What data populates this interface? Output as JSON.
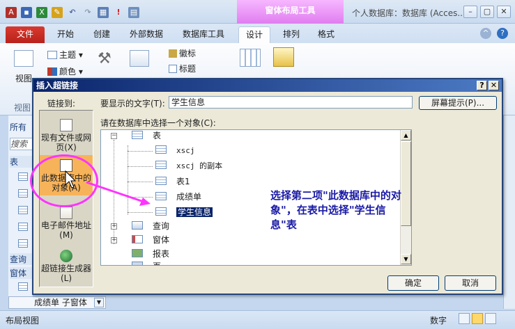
{
  "app": {
    "title": "个人数据库：数据库 (Acces...",
    "context_tab": "窗体布局工具",
    "tabs": [
      "文件",
      "开始",
      "创建",
      "外部数据",
      "数据库工具",
      "设计",
      "排列",
      "格式"
    ]
  },
  "ribbon": {
    "view": "视图",
    "theme": "主题",
    "colors": "颜色",
    "logo": "徽标",
    "title": "标题",
    "view_group": "视图"
  },
  "nav": {
    "all": "所有",
    "search": "搜索",
    "tables": "表",
    "queries": "查询",
    "forms": "窗体"
  },
  "form_tab": "成绩单 子窗体",
  "status": {
    "left": "布局视图",
    "right": "数字"
  },
  "dialog": {
    "title": "插入超链接",
    "help_btn": "?",
    "close_btn": "✕",
    "link_to_label": "链接到:",
    "link_options": {
      "existing_line1": "现有文件或网",
      "existing_line2": "页(X)",
      "thisdb_line1": "此数据库中的",
      "thisdb_line2": "对象(A)",
      "email_line1": "电子邮件地址",
      "email_line2": "(M)",
      "builder_line1": "超链接生成器",
      "builder_line2": "(L)"
    },
    "display_label": "要显示的文字(T):",
    "display_value": "学生信息",
    "screentip": "屏幕提示(P)...",
    "select_label": "请在数据库中选择一个对象(C):",
    "tree": {
      "tables": "表",
      "items": [
        "xscj",
        "xscj 的副本",
        "表1",
        "成绩单",
        "学生信息"
      ],
      "queries": "查询",
      "forms": "窗体",
      "reports": "报表",
      "pages": "页"
    },
    "ok": "确定",
    "cancel": "取消"
  },
  "annotation": "选择第二项\"此数据库中的对象\"，在表中选择\"学生信息\"表",
  "colors": {
    "accent_pink": "#ff33ff",
    "annotation_blue": "#1a1aa6",
    "selected_option": "#f7b35a"
  }
}
